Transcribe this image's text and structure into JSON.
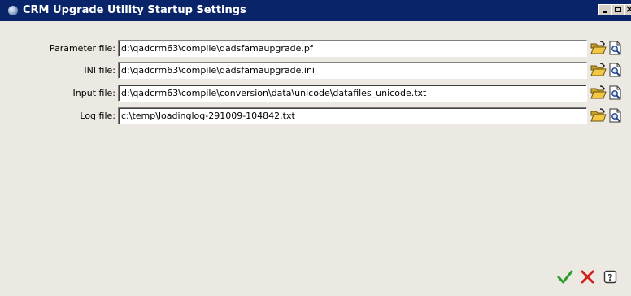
{
  "window": {
    "title": "CRM Upgrade Utility Startup Settings",
    "icon": "app-globe-icon",
    "controls": [
      "minimize-icon",
      "maximize-icon",
      "close-icon"
    ]
  },
  "fields": [
    {
      "label": "Parameter file:",
      "value": "d:\\qadcrm63\\compile\\qadsfamaupgrade.pf"
    },
    {
      "label": "INI file:",
      "value": "d:\\qadcrm63\\compile\\qadsfamaupgrade.ini"
    },
    {
      "label": "Input file:",
      "value": "d:\\qadcrm63\\compile\\conversion\\data\\unicode\\datafiles_unicode.txt"
    },
    {
      "label": "Log file:",
      "value": "c:\\temp\\loadinglog-291009-104842.txt"
    }
  ],
  "row_buttons": [
    "open-folder-icon",
    "view-file-icon"
  ],
  "footer_actions": [
    {
      "icon": "check-icon",
      "color": "#2e9e2e"
    },
    {
      "icon": "cancel-x-icon",
      "color": "#d0201c"
    },
    {
      "icon": "help-icon",
      "color": "#333333"
    }
  ],
  "colors": {
    "titlebar": "#0a246a",
    "dialog_background": "#ece9e2",
    "folder_yellow": "#f2c744"
  }
}
